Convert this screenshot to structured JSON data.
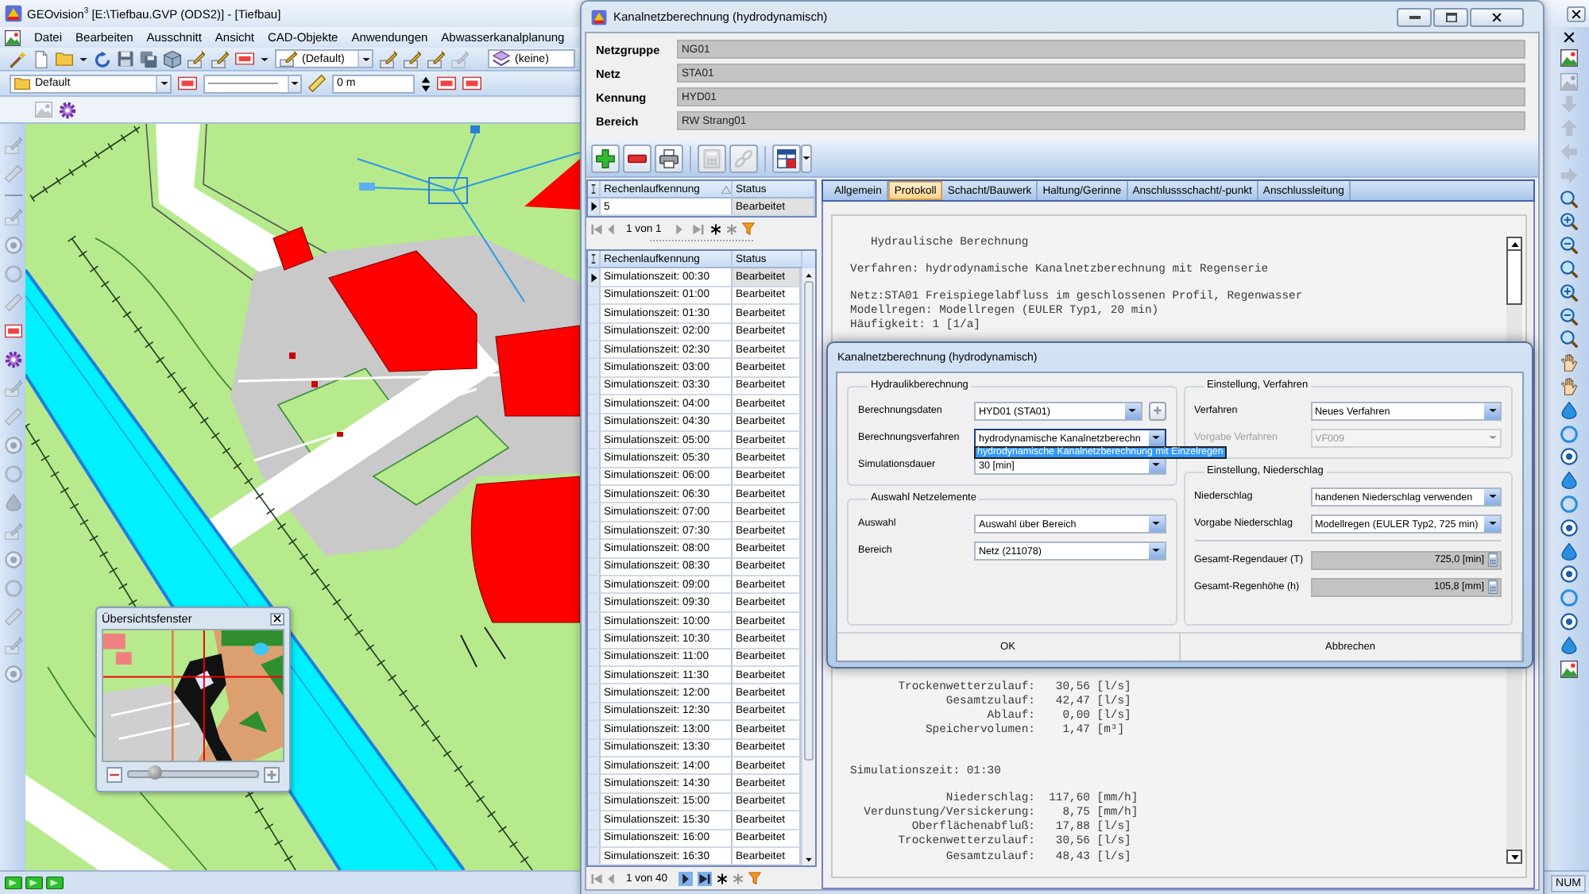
{
  "app": {
    "title": "GEOvision$^{3}$ [E:\\Tiefbau.GVP (ODS2)] - [Tiefbau]",
    "menu": [
      "Datei",
      "Bearbeiten",
      "Ausschnitt",
      "Ansicht",
      "CAD-Objekte",
      "Anwendungen",
      "Abwasserkanalplanung"
    ],
    "toolbar": {
      "style_combo": "(Default)",
      "layer_combo": "(keine)",
      "default_combo": "Default",
      "distance_field": "0 m"
    },
    "overview": {
      "title": "Übersichtsfenster",
      "zoom": {
        "level": 0.2
      }
    },
    "status_bar": {
      "mode": "NUM"
    }
  },
  "window": {
    "title": "Kanalnetzberechnung (hydrodynamisch)",
    "fields": [
      {
        "label": "Netzgruppe",
        "value": "NG01"
      },
      {
        "label": "Netz",
        "value": "STA01"
      },
      {
        "label": "Kennung",
        "value": "HYD01"
      },
      {
        "label": "Bereich",
        "value": "RW Strang01"
      }
    ],
    "toolbar": [
      {
        "kind": "add",
        "disabled": false
      },
      {
        "kind": "remove",
        "disabled": false
      },
      {
        "kind": "print",
        "disabled": false
      },
      {
        "kind": "calculator",
        "disabled": true
      },
      {
        "kind": "link",
        "disabled": true
      },
      {
        "kind": "table",
        "disabled": false
      }
    ],
    "runs_table": {
      "columns": [
        {
          "label": "Rechenlaufkennung",
          "sorted": true
        },
        {
          "label": "Status",
          "sorted": false
        }
      ],
      "rows": [
        {
          "cells": [
            "5",
            "Bearbeitet"
          ],
          "selected": true
        }
      ],
      "pager": {
        "label": "1 von 1",
        "back_disabled": true,
        "forward_disabled": true
      }
    },
    "times_table": {
      "columns": [
        {
          "label": "Rechenlaufkennung",
          "sorted": false
        },
        {
          "label": "Status",
          "sorted": false
        }
      ],
      "rows": [
        {
          "cells": [
            "Simulationszeit: 00:30",
            "Bearbeitet"
          ],
          "selected": true
        },
        {
          "cells": [
            "Simulationszeit: 01:00",
            "Bearbeitet"
          ],
          "selected": false
        },
        {
          "cells": [
            "Simulationszeit: 01:30",
            "Bearbeitet"
          ],
          "selected": false
        },
        {
          "cells": [
            "Simulationszeit: 02:00",
            "Bearbeitet"
          ],
          "selected": false
        },
        {
          "cells": [
            "Simulationszeit: 02:30",
            "Bearbeitet"
          ],
          "selected": false
        },
        {
          "cells": [
            "Simulationszeit: 03:00",
            "Bearbeitet"
          ],
          "selected": false
        },
        {
          "cells": [
            "Simulationszeit: 03:30",
            "Bearbeitet"
          ],
          "selected": false
        },
        {
          "cells": [
            "Simulationszeit: 04:00",
            "Bearbeitet"
          ],
          "selected": false
        },
        {
          "cells": [
            "Simulationszeit: 04:30",
            "Bearbeitet"
          ],
          "selected": false
        },
        {
          "cells": [
            "Simulationszeit: 05:00",
            "Bearbeitet"
          ],
          "selected": false
        },
        {
          "cells": [
            "Simulationszeit: 05:30",
            "Bearbeitet"
          ],
          "selected": false
        },
        {
          "cells": [
            "Simulationszeit: 06:00",
            "Bearbeitet"
          ],
          "selected": false
        },
        {
          "cells": [
            "Simulationszeit: 06:30",
            "Bearbeitet"
          ],
          "selected": false
        },
        {
          "cells": [
            "Simulationszeit: 07:00",
            "Bearbeitet"
          ],
          "selected": false
        },
        {
          "cells": [
            "Simulationszeit: 07:30",
            "Bearbeitet"
          ],
          "selected": false
        },
        {
          "cells": [
            "Simulationszeit: 08:00",
            "Bearbeitet"
          ],
          "selected": false
        },
        {
          "cells": [
            "Simulationszeit: 08:30",
            "Bearbeitet"
          ],
          "selected": false
        },
        {
          "cells": [
            "Simulationszeit: 09:00",
            "Bearbeitet"
          ],
          "selected": false
        },
        {
          "cells": [
            "Simulationszeit: 09:30",
            "Bearbeitet"
          ],
          "selected": false
        },
        {
          "cells": [
            "Simulationszeit: 10:00",
            "Bearbeitet"
          ],
          "selected": false
        },
        {
          "cells": [
            "Simulationszeit: 10:30",
            "Bearbeitet"
          ],
          "selected": false
        },
        {
          "cells": [
            "Simulationszeit: 11:00",
            "Bearbeitet"
          ],
          "selected": false
        },
        {
          "cells": [
            "Simulationszeit: 11:30",
            "Bearbeitet"
          ],
          "selected": false
        },
        {
          "cells": [
            "Simulationszeit: 12:00",
            "Bearbeitet"
          ],
          "selected": false
        },
        {
          "cells": [
            "Simulationszeit: 12:30",
            "Bearbeitet"
          ],
          "selected": false
        },
        {
          "cells": [
            "Simulationszeit: 13:00",
            "Bearbeitet"
          ],
          "selected": false
        },
        {
          "cells": [
            "Simulationszeit: 13:30",
            "Bearbeitet"
          ],
          "selected": false
        },
        {
          "cells": [
            "Simulationszeit: 14:00",
            "Bearbeitet"
          ],
          "selected": false
        },
        {
          "cells": [
            "Simulationszeit: 14:30",
            "Bearbeitet"
          ],
          "selected": false
        },
        {
          "cells": [
            "Simulationszeit: 15:00",
            "Bearbeitet"
          ],
          "selected": false
        },
        {
          "cells": [
            "Simulationszeit: 15:30",
            "Bearbeitet"
          ],
          "selected": false
        },
        {
          "cells": [
            "Simulationszeit: 16:00",
            "Bearbeitet"
          ],
          "selected": false
        },
        {
          "cells": [
            "Simulationszeit: 16:30",
            "Bearbeitet"
          ],
          "selected": false
        }
      ],
      "pager": {
        "label": "1 von 40",
        "back_disabled": true,
        "forward_disabled": false
      }
    },
    "tabs": [
      {
        "label": "Allgemein",
        "selected": false
      },
      {
        "label": "Protokoll",
        "selected": true
      },
      {
        "label": "Schacht/Bauwerk",
        "selected": false
      },
      {
        "label": "Haltung/Gerinne",
        "selected": false
      },
      {
        "label": "Anschlussschacht/-punkt",
        "selected": false
      },
      {
        "label": "Anschlussleitung",
        "selected": false
      }
    ],
    "protocol": {
      "upper": [
        [
          {
            "kind": "title",
            "text": "Hydraulische Berechnung"
          }
        ],
        [
          {
            "kind": "text",
            "text": "Verfahren: hydrodynamische Kanalnetzberechnung mit Regenserie"
          }
        ],
        [
          {
            "kind": "text",
            "text": "Netz:STA01 Freispiegelabfluss im geschlossenen Profil, Regenwasser"
          },
          {
            "kind": "text",
            "text": "Modellregen: Modellregen (EULER Typ1, 20 min)"
          },
          {
            "kind": "text",
            "text": "Häufigkeit: 1 [1/a]"
          }
        ]
      ],
      "lower": [
        [
          {
            "kind": "text",
            "text": "       Trockenwetterzulauf:   30,56 [l/s]"
          },
          {
            "kind": "text",
            "text": "              Gesamtzulauf:   42,47 [l/s]"
          },
          {
            "kind": "text",
            "text": "                    Ablauf:    0,00 [l/s]"
          },
          {
            "kind": "text",
            "text": "           Speichervolumen:    1,47 [m³]"
          }
        ],
        [
          {
            "kind": "section",
            "text": "Simulationszeit: 01:30"
          }
        ],
        [
          {
            "kind": "text",
            "text": "              Niederschlag:  117,60 [mm/h]"
          },
          {
            "kind": "text",
            "text": "  Verdunstung/Versickerung:    8,75 [mm/h]"
          },
          {
            "kind": "text",
            "text": "         Oberflächenabfluß:   17,88 [l/s]"
          },
          {
            "kind": "text",
            "text": "       Trockenwetterzulauf:   30,56 [l/s]"
          },
          {
            "kind": "text",
            "text": "              Gesamtzulauf:   48,43 [l/s]"
          }
        ]
      ]
    }
  },
  "dialog": {
    "title": "Kanalnetzberechnung (hydrodynamisch)",
    "left_groups": [
      {
        "title": "Hydraulikberechnung",
        "rows": [
          {
            "kind": "combo_button",
            "label": "Berechnungsdaten",
            "value": "HYD01 (STA01)",
            "expanded": false,
            "disabled": false
          },
          {
            "kind": "combo",
            "label": "Berechnungsverfahren",
            "value": "hydrodynamische Kanalnetzberechn",
            "expanded": true,
            "disabled": false,
            "options": [
              {
                "label": "hydrodynamische Kanalnetzberechnung mit Einzelregen",
                "selected": true
              }
            ]
          },
          {
            "kind": "combo",
            "label": "Simulationsdauer",
            "value": "30 [min]",
            "expanded": false,
            "disabled": false
          }
        ]
      },
      {
        "title": "Auswahl Netzelemente",
        "rows": [
          {
            "kind": "combo",
            "label": "Auswahl",
            "value": "Auswahl über Bereich",
            "expanded": false,
            "disabled": false
          },
          {
            "kind": "combo",
            "label": "Bereich",
            "value": "Netz (211078)",
            "expanded": false,
            "disabled": false
          }
        ]
      }
    ],
    "right_groups": [
      {
        "title": "Einstellung, Verfahren",
        "rows": [
          {
            "kind": "combo",
            "label": "Verfahren",
            "value": "Neues Verfahren",
            "expanded": false,
            "disabled": false
          },
          {
            "kind": "combo",
            "label": "Vorgabe Verfahren",
            "value": "VF009",
            "expanded": false,
            "disabled": true
          }
        ]
      },
      {
        "title": "Einstellung, Niederschlag",
        "rows": [
          {
            "kind": "combo",
            "label": "Niederschlag",
            "value": "handenen Niederschlag verwenden",
            "expanded": false,
            "disabled": false
          },
          {
            "kind": "combo",
            "label": "Vorgabe Niederschlag",
            "value": "Modellregen (EULER Typ2, 725 min)",
            "expanded": false,
            "disabled": false
          },
          {
            "kind": "readonly",
            "label": "Gesamt-Regendauer (T)",
            "value": "725,0 [min]"
          },
          {
            "kind": "readonly",
            "label": "Gesamt-Regenhöhe (h)",
            "value": "105,8 [mm]"
          }
        ]
      }
    ],
    "buttons": [
      "OK",
      "Abbrechen"
    ]
  }
}
